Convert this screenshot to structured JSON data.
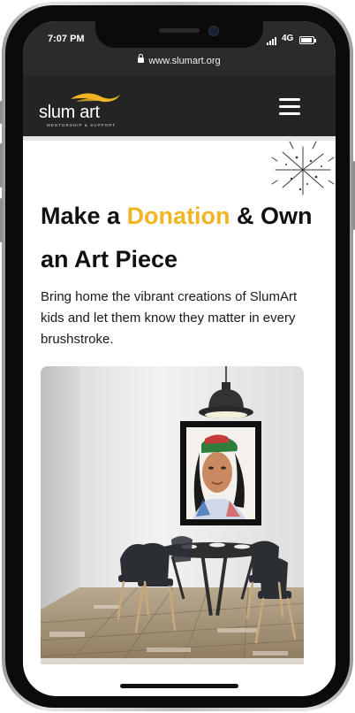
{
  "status_bar": {
    "time": "7:07 PM",
    "network": "4G"
  },
  "browser": {
    "url": "www.slumart.org"
  },
  "header": {
    "logo_text": "slum art",
    "logo_tagline": "MENTORSHIP & SUPPORT",
    "menu_icon": "hamburger-menu-icon"
  },
  "hero": {
    "heading_pre": "Make a ",
    "heading_accent": "Donation",
    "heading_post": " & Own an Art Piece",
    "intro": "Bring home the vibrant creations of SlumArt kids and let them know they matter in every brushstroke."
  },
  "image": {
    "description_icon": "dining-room-with-framed-portrait"
  },
  "colors": {
    "accent": "#f1b523",
    "header_bg": "#242424",
    "text": "#111111"
  }
}
